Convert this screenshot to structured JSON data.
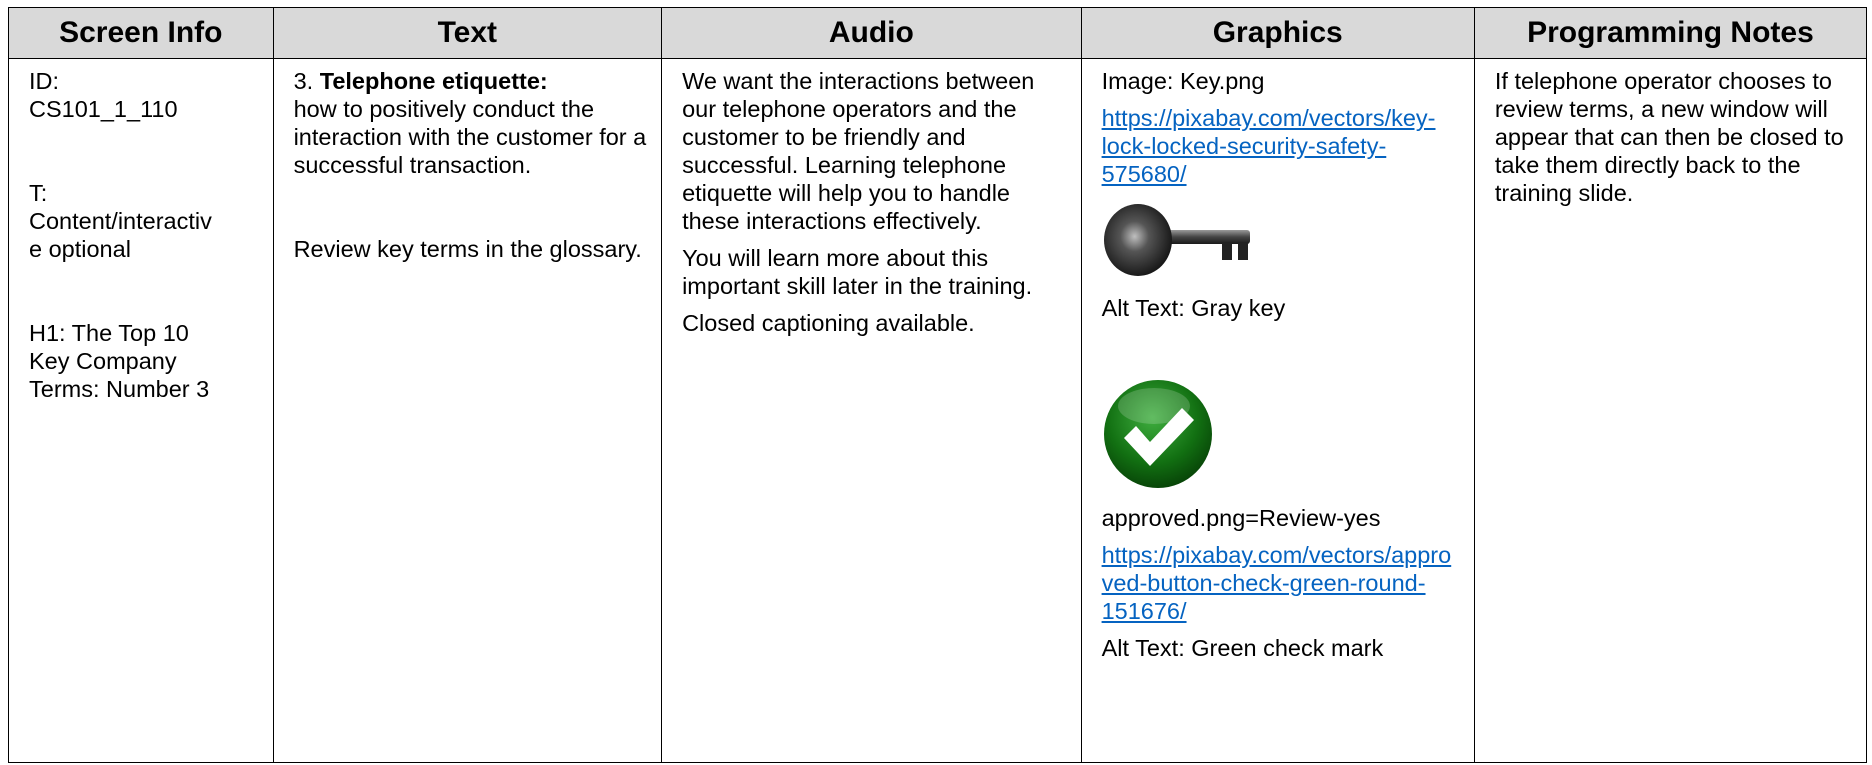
{
  "headers": {
    "screen_info": "Screen Info",
    "text": "Text",
    "audio": "Audio",
    "graphics": "Graphics",
    "programming_notes": "Programming Notes"
  },
  "screen_info": {
    "id_label": "ID:",
    "id_value": "CS101_1_110",
    "type_label": "T:",
    "type_value_line1": "Content/interactiv",
    "type_value_line2": "e optional",
    "h1_line1": "H1: The Top 10",
    "h1_line2": "Key Company",
    "h1_line3": "Terms: Number 3"
  },
  "text_col": {
    "number": "3. ",
    "term": "Telephone etiquette:",
    "definition": "how to positively conduct the interaction with the customer for a successful transaction.",
    "review": "Review key terms in the glossary."
  },
  "audio": {
    "paragraph1": "We want the interactions between our telephone operators and the customer to be friendly and successful. Learning telephone etiquette will help you to handle these interactions effectively.",
    "paragraph2": "You will learn more about this important skill later in the training.",
    "paragraph3": "Closed captioning available."
  },
  "graphics": {
    "image1_label": "Image: Key.png",
    "image1_url": "https://pixabay.com/vectors/key-lock-locked-security-safety-575680/",
    "image1_alt": "Alt Text: Gray key",
    "image1_icon": "key-icon",
    "image2_label": "approved.png=Review-yes",
    "image2_url": "https://pixabay.com/vectors/approved-button-check-green-round-151676/",
    "image2_alt": "Alt Text: Green check mark",
    "image2_icon": "check-mark-icon",
    "link_color": "#0563c1",
    "check_color": "#1a7a1a"
  },
  "programming_notes": {
    "note": "If telephone operator chooses to review terms, a new window will appear that can then be closed to take them directly back to the training slide."
  },
  "colors": {
    "header_bg": "#d9d9d9",
    "border": "#000000"
  }
}
